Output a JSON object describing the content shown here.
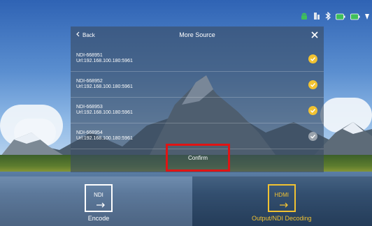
{
  "dialog": {
    "back_label": "Back",
    "title": "More Source",
    "confirm_label": "Confirm"
  },
  "sources": [
    {
      "name": "NDI-668951",
      "url": "Url:192.168.100.180:5961",
      "checked": true
    },
    {
      "name": "NDI-668952",
      "url": "Url:192.168.100.180:5961",
      "checked": true
    },
    {
      "name": "NDI-668953",
      "url": "Url:192.168.100.180:5961",
      "checked": true
    },
    {
      "name": "NDI-668954",
      "url": "Url:192.168.100.180:5961",
      "checked": false
    }
  ],
  "modes": {
    "encode": {
      "box_label": "NDI",
      "caption": "Encode"
    },
    "decode": {
      "box_label": "HDMI",
      "caption": "Output/NDI Decoding"
    }
  },
  "colors": {
    "check_active": "#f1c232",
    "check_inactive": "#9aa3ad",
    "highlight": "#e01414",
    "accent": "#f1c232"
  },
  "status_icons": [
    "android-icon",
    "sim-icon",
    "bluetooth-icon",
    "battery-icon",
    "battery-icon",
    "wifi-icon"
  ]
}
